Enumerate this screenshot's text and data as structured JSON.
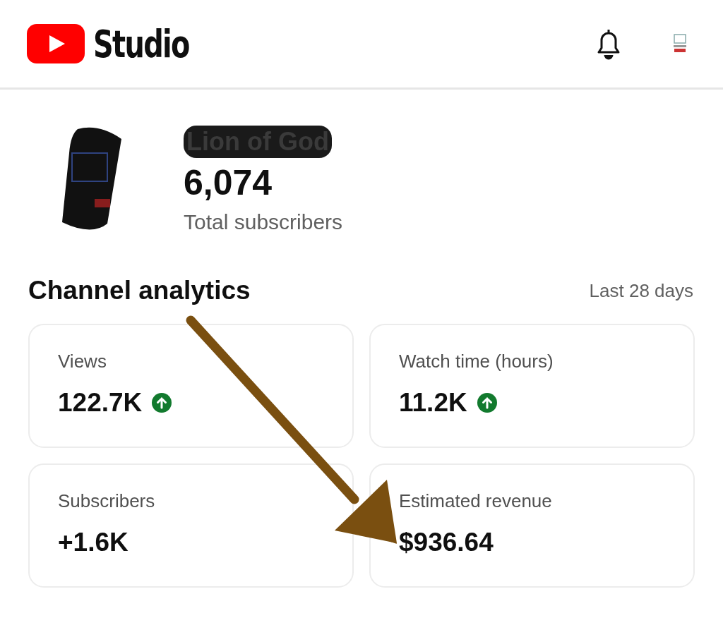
{
  "header": {
    "logo_text": "Studio"
  },
  "channel": {
    "name": "Lion of God",
    "subscriber_count": "6,074",
    "subscriber_label": "Total subscribers"
  },
  "analytics": {
    "title": "Channel analytics",
    "period": "Last 28 days",
    "cards": [
      {
        "label": "Views",
        "value": "122.7K",
        "trend_up": true
      },
      {
        "label": "Watch time (hours)",
        "value": "11.2K",
        "trend_up": true
      },
      {
        "label": "Subscribers",
        "value": "+1.6K",
        "trend_up": false
      },
      {
        "label": "Estimated revenue",
        "value": "$936.64",
        "trend_up": false
      }
    ]
  }
}
